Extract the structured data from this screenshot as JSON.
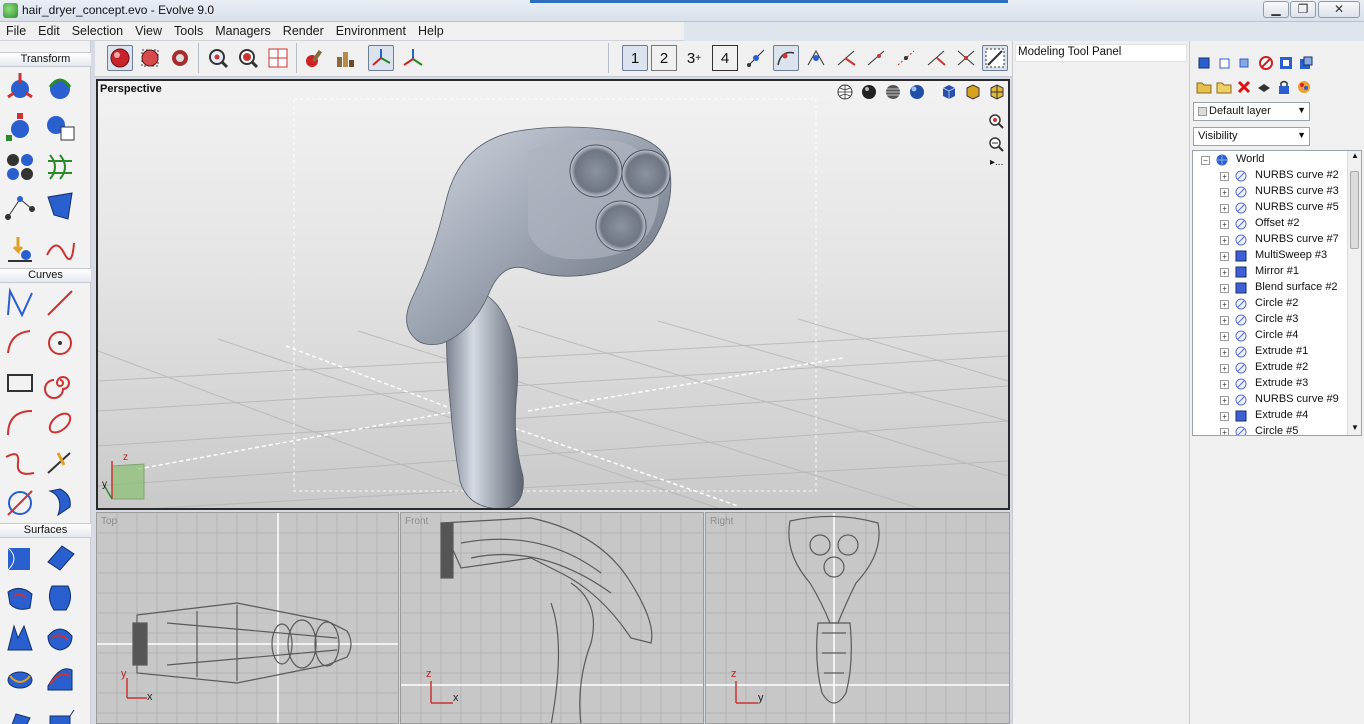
{
  "window": {
    "title": "hair_dryer_concept.evo - Evolve 9.0",
    "min_glyph": "▁",
    "max_glyph": "❐",
    "close_glyph": "✕"
  },
  "menu": [
    "File",
    "Edit",
    "Selection",
    "View",
    "Tools",
    "Managers",
    "Render",
    "Environment",
    "Help"
  ],
  "toolbar": {
    "view_layout_labels": [
      "1",
      "2",
      "3",
      "4"
    ],
    "view_layout_plus": "+"
  },
  "palette": {
    "sections": [
      "Transform",
      "Curves",
      "Surfaces"
    ]
  },
  "viewports": {
    "main": {
      "label": "Perspective",
      "more_glyph": "▸..."
    },
    "small": [
      {
        "label": "Top",
        "axes": [
          "y",
          "x"
        ]
      },
      {
        "label": "Front",
        "axes": [
          "z",
          "x"
        ]
      },
      {
        "label": "Right",
        "axes": [
          "z",
          "y"
        ]
      }
    ],
    "main_axes": [
      "z",
      "y"
    ]
  },
  "modeling_panel": {
    "title": "Modeling Tool Panel"
  },
  "scene_panel": {
    "layer_dropdown": "Default layer",
    "filter_dropdown": "Visibility",
    "tree_root": "World",
    "tree_items": [
      {
        "label": "NURBS curve #2",
        "icon": "curve-icon"
      },
      {
        "label": "NURBS curve #3",
        "icon": "curve-icon"
      },
      {
        "label": "NURBS curve #5",
        "icon": "curve-icon"
      },
      {
        "label": "Offset #2",
        "icon": "curve-icon"
      },
      {
        "label": "NURBS curve #7",
        "icon": "curve-icon"
      },
      {
        "label": "MultiSweep #3",
        "icon": "surface-icon"
      },
      {
        "label": "Mirror #1",
        "icon": "surface-icon"
      },
      {
        "label": "Blend surface #2",
        "icon": "surface-icon"
      },
      {
        "label": "Circle #2",
        "icon": "curve-icon"
      },
      {
        "label": "Circle #3",
        "icon": "curve-icon"
      },
      {
        "label": "Circle #4",
        "icon": "curve-icon"
      },
      {
        "label": "Extrude #1",
        "icon": "curve-icon"
      },
      {
        "label": "Extrude #2",
        "icon": "curve-icon"
      },
      {
        "label": "Extrude #3",
        "icon": "curve-icon"
      },
      {
        "label": "NURBS curve #9",
        "icon": "curve-icon"
      },
      {
        "label": "Extrude #4",
        "icon": "surface-icon"
      },
      {
        "label": "Circle #5",
        "icon": "curve-icon"
      }
    ]
  },
  "colors": {
    "accent": "#2f6fc0",
    "viewport_border": "#2a2a2a",
    "surface_icon": "#3f5fd8",
    "curve_icon": "#5a6fd0"
  }
}
